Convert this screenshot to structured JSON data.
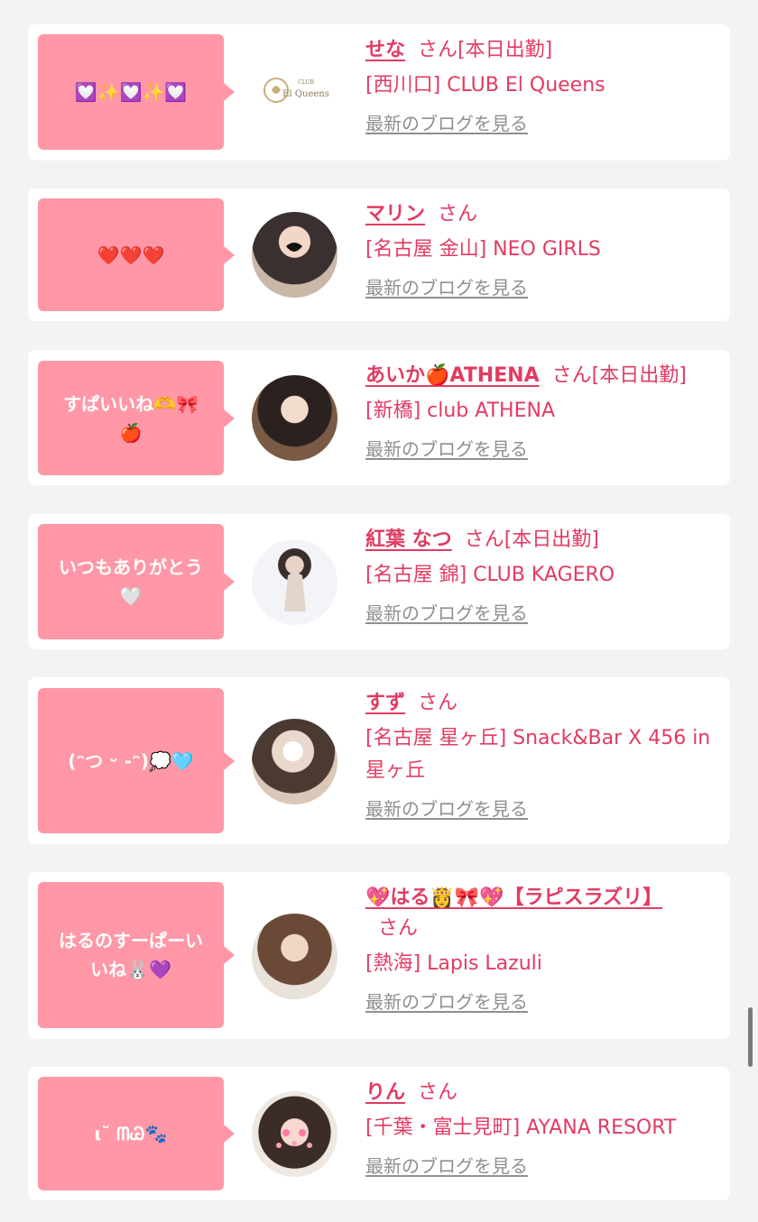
{
  "entries": [
    {
      "bubble": "💟✨💟✨💟",
      "name": "せな",
      "san": "さん",
      "status": "[本日出勤]",
      "store": "[西川口] CLUB El Queens",
      "blog_link": "最新のブログを見る",
      "logo_text": {
        "club": "CLUB",
        "name": "El Queens"
      }
    },
    {
      "bubble": "❤️❤️❤️",
      "name": "マリン",
      "san": "さん",
      "status": "",
      "store": "[名古屋 金山] NEO GIRLS",
      "blog_link": "最新のブログを見る"
    },
    {
      "bubble": "すぱいいね🫶🎀\n🍎",
      "name": "あいか🍎ATHENA",
      "san": "さん",
      "status": "[本日出勤]",
      "store": "[新橋] club ATHENA",
      "blog_link": "最新のブログを見る"
    },
    {
      "bubble": "いつもありがとう\n🤍",
      "name": "紅葉 なつ",
      "san": "さん",
      "status": "[本日出勤]",
      "store": "[名古屋 錦] CLUB KAGERO",
      "blog_link": "最新のブログを見る"
    },
    {
      "bubble": "(ᵔつ ᵕ -ᵔ)💭🩵",
      "name": "すず",
      "san": "さん",
      "status": "",
      "store": "[名古屋 星ヶ丘] Snack&Bar X 456 in 星ヶ丘",
      "blog_link": "最新のブログを見る"
    },
    {
      "bubble": "はるのすーぱーい\nいね🐰💜",
      "name": "💖はる👸🎀💖【ラピスラズリ】",
      "san": "さん",
      "status": "",
      "store": "[熱海] Lapis Lazuli",
      "blog_link": "最新のブログを見る"
    },
    {
      "bubble": "ι˘ ᗰᏊ🐾",
      "name": "りん",
      "san": "さん",
      "status": "",
      "store": "[千葉・富士見町] AYANA RESORT",
      "blog_link": "最新のブログを見る"
    }
  ],
  "colors": {
    "accent": "#e23b62",
    "bubble": "#ff97a7",
    "link_gray": "#8f8f8f",
    "page_bg": "#f3f3f3"
  }
}
